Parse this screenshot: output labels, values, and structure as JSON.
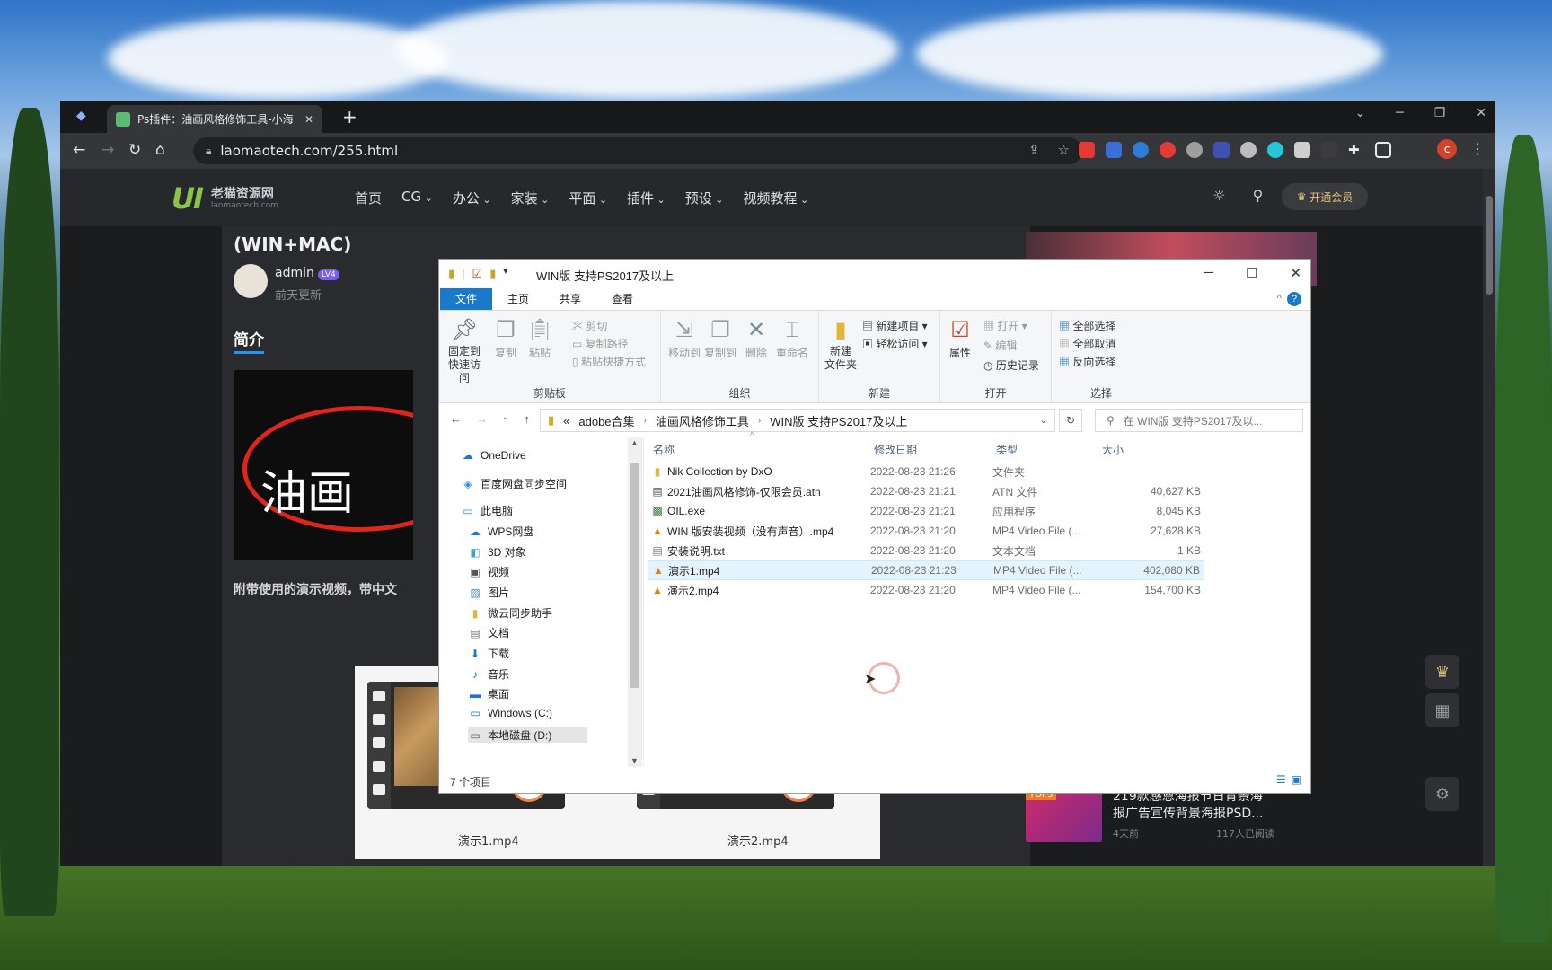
{
  "browser": {
    "tab_title": "Ps插件：油画风格修饰工具-小海",
    "tab_close": "✕",
    "new_tab": "+",
    "url": "laomaotech.com/255.html",
    "profile_initial": "c"
  },
  "site": {
    "logo_mark": "UI",
    "logo_name": "老猫资源网",
    "logo_sub": "laomaotech.com",
    "nav": [
      "首页",
      "CG",
      "办公",
      "家装",
      "平面",
      "插件",
      "预设",
      "视频教程"
    ],
    "vip_label": "开通会员"
  },
  "article": {
    "title": "(WIN+MAC)",
    "author": "admin",
    "level_badge": "LV4",
    "updated": "前天更新",
    "section": "简介",
    "thumb_text": "油画",
    "demo_note": "附带使用的演示视频，带中文",
    "videos": [
      "演示1.mp4",
      "演示2.mp4"
    ]
  },
  "sidebar": {
    "top3_tag": "TOP3",
    "top3_title": "219款感恩海报节日背景海报广告宣传背景海报PSD...",
    "top3_time": "4天前",
    "top3_reads": "117人已阅读"
  },
  "explorer": {
    "title": "WIN版 支持PS2017及以上",
    "tabs": [
      "文件",
      "主页",
      "共享",
      "查看"
    ],
    "ribbon": {
      "clipboard": {
        "caption": "剪贴板",
        "pin": "固定到\n快速访问",
        "copy": "复制",
        "paste": "粘贴",
        "cut": "剪切",
        "copy_path": "复制路径",
        "paste_shortcut": "粘贴快捷方式"
      },
      "organize": {
        "caption": "组织",
        "move_to": "移动到",
        "copy_to": "复制到",
        "delete": "删除",
        "rename": "重命名"
      },
      "new": {
        "caption": "新建",
        "new_folder": "新建\n文件夹",
        "new_item": "新建项目 ▾",
        "easy_access": "轻松访问 ▾"
      },
      "open": {
        "caption": "打开",
        "properties": "属性",
        "open": "打开 ▾",
        "edit": "编辑",
        "history": "历史记录"
      },
      "select": {
        "caption": "选择",
        "select_all": "全部选择",
        "select_none": "全部取消",
        "invert": "反向选择"
      }
    },
    "breadcrumb": [
      "«",
      "adobe合集",
      "油画风格修饰工具",
      "WIN版 支持PS2017及以上"
    ],
    "search_placeholder": "在 WIN版 支持PS2017及以...",
    "nav_items": [
      "OneDrive",
      "百度网盘同步空间",
      "此电脑",
      "WPS网盘",
      "3D 对象",
      "视频",
      "图片",
      "微云同步助手",
      "文档",
      "下载",
      "音乐",
      "桌面",
      "Windows (C:)",
      "本地磁盘 (D:)"
    ],
    "columns": [
      "名称",
      "修改日期",
      "类型",
      "大小"
    ],
    "files": [
      {
        "name": "Nik Collection by DxO",
        "date": "2022-08-23 21:26",
        "type": "文件夹",
        "size": ""
      },
      {
        "name": "2021油画风格修饰-仅限会员.atn",
        "date": "2022-08-23 21:21",
        "type": "ATN 文件",
        "size": "40,627 KB"
      },
      {
        "name": "OIL.exe",
        "date": "2022-08-23 21:21",
        "type": "应用程序",
        "size": "8,045 KB"
      },
      {
        "name": "WIN 版安装视频（没有声音）.mp4",
        "date": "2022-08-23 21:20",
        "type": "MP4 Video File (...",
        "size": "27,628 KB"
      },
      {
        "name": "安装说明.txt",
        "date": "2022-08-23 21:20",
        "type": "文本文档",
        "size": "1 KB"
      },
      {
        "name": "演示1.mp4",
        "date": "2022-08-23 21:23",
        "type": "MP4 Video File (...",
        "size": "402,080 KB"
      },
      {
        "name": "演示2.mp4",
        "date": "2022-08-23 21:20",
        "type": "MP4 Video File (...",
        "size": "154,700 KB"
      }
    ],
    "status": "7 个项目"
  }
}
